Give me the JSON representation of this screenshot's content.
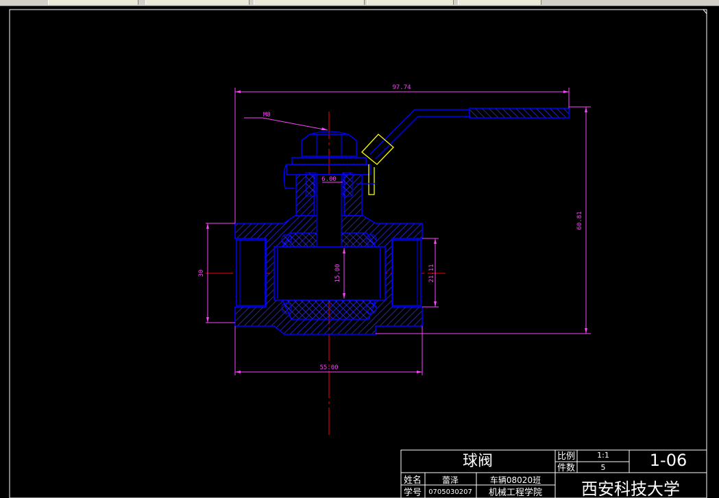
{
  "drawing": {
    "dimensions": {
      "overall_width": "97.74",
      "thread": "M8",
      "stem_width": "6.00",
      "height_left": "30",
      "bore": "15.00",
      "port": "21.11",
      "overall_height": "60.81",
      "body_length": "55.00"
    }
  },
  "title_block": {
    "part_name": "球阀",
    "scale_label": "比例",
    "scale_value": "1:1",
    "qty_label": "件数",
    "qty_value": "5",
    "drawing_no": "1-06",
    "name_label": "姓名",
    "name_value": "蕾泽",
    "class_value": "车辆08020班",
    "id_label": "学号",
    "id_value": "0705030207",
    "college": "机械工程学院",
    "university": "西安科技大学"
  },
  "colors": {
    "frame": "#ffffff",
    "outline": "#0000ff",
    "hatch": "#3333ff",
    "dimension": "#ff40ff",
    "centerline": "#ff0000",
    "handle_highlight": "#ffff00"
  }
}
